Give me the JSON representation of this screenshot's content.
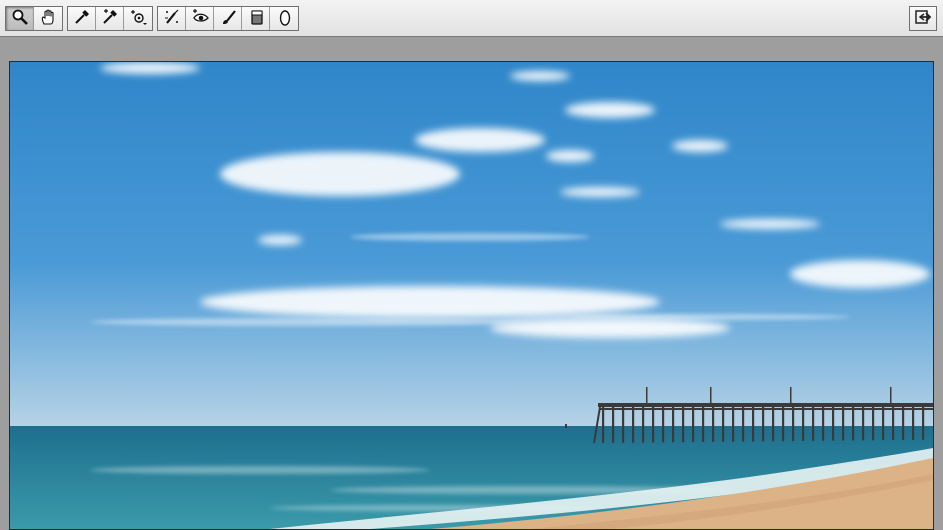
{
  "toolbar": {
    "groups": [
      [
        {
          "name": "zoom-tool",
          "icon": "magnifier-icon",
          "active": true
        },
        {
          "name": "hand-tool",
          "icon": "hand-icon",
          "active": false
        }
      ],
      [
        {
          "name": "white-balance-tool",
          "icon": "eyedropper-icon",
          "active": false
        },
        {
          "name": "color-sampler-tool",
          "icon": "eyedropper-plus-icon",
          "active": false
        },
        {
          "name": "targeted-adjustment-tool",
          "icon": "target-adjust-icon",
          "active": false
        }
      ],
      [
        {
          "name": "spot-removal-tool",
          "icon": "spot-brush-icon",
          "active": false
        },
        {
          "name": "red-eye-tool",
          "icon": "eye-icon",
          "active": false
        },
        {
          "name": "adjustment-brush-tool",
          "icon": "brush-icon",
          "active": false
        },
        {
          "name": "graduated-filter-tool",
          "icon": "gradient-rect-icon",
          "active": false
        },
        {
          "name": "radial-filter-tool",
          "icon": "ellipse-icon",
          "active": false
        }
      ]
    ],
    "right_button": {
      "name": "toggle-fullscreen-button",
      "icon": "arrow-exit-icon"
    }
  },
  "colors": {
    "sky_top": "#2f86c9",
    "sky_mid": "#4a9ad6",
    "sky_horizon": "#b7d3e6",
    "sea_far": "#1e6f8e",
    "sea_near": "#3a9aaa",
    "sand": "#dcb386",
    "pier": "#3a3a3a"
  }
}
